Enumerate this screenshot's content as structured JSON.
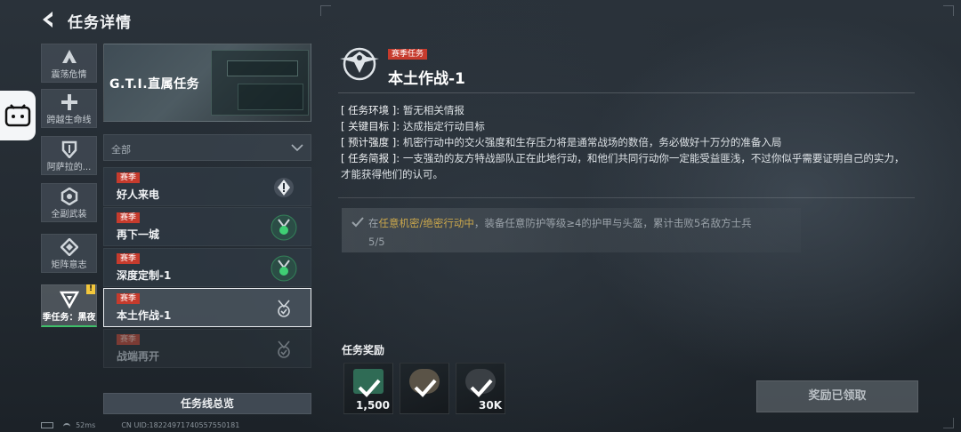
{
  "header": {
    "title": "任务详情"
  },
  "categories": [
    {
      "label": "震荡危情",
      "icon": "stacked-chevron-icon",
      "active": false
    },
    {
      "label": "跨越生命线",
      "icon": "cross-icon",
      "active": false
    },
    {
      "label": "阿萨拉的...",
      "icon": "shield-icon",
      "active": false
    },
    {
      "label": "全副武装",
      "icon": "ring-emblem-icon",
      "active": false
    },
    {
      "label": "矩阵意志",
      "icon": "diamond-arrows-icon",
      "active": false
    },
    {
      "label": "赛季任务：黑夜",
      "icon": "triangle-emblem-icon",
      "active": true,
      "badge": "!"
    }
  ],
  "banner": {
    "title": "G.T.I.直属任务"
  },
  "filter": {
    "selected": "全部"
  },
  "missions": [
    {
      "tag": "赛季",
      "name": "好人来电",
      "status": "alert-icon"
    },
    {
      "tag": "赛季",
      "name": "再下一城",
      "status": "medal-icon"
    },
    {
      "tag": "赛季",
      "name": "深度定制-1",
      "status": "medal-icon"
    },
    {
      "tag": "赛季",
      "name": "本土作战-1",
      "status": "completed-medal-icon"
    },
    {
      "tag": "赛季",
      "name": "战端再开",
      "status": "locked-medal-icon"
    }
  ],
  "overview_button": "任务线总览",
  "status_bar": {
    "ping": "52ms",
    "uid": "CN UID:18224971740557550181"
  },
  "detail": {
    "tag": "赛季任务",
    "title": "本土作战-1",
    "info": [
      {
        "key": "[ 任务环境 ]:",
        "value": "暂无相关情报"
      },
      {
        "key": "[ 关键目标 ]:",
        "value": "达成指定行动目标"
      },
      {
        "key": "[ 预计强度 ]:",
        "value": "机密行动中的交火强度和生存压力将是通常战场的数倍，务必做好十万分的准备入局"
      },
      {
        "key": "[ 任务简报 ]:",
        "value": "一支强劲的友方特战部队正在此地行动，和他们共同行动你一定能受益匪浅，不过你似乎需要证明自己的实力，才能获得他们的认可。"
      }
    ],
    "objective": {
      "prefix": "在",
      "highlight": "任意机密/绝密行动中",
      "suffix": "，装备任意防护等级≥4的护甲与头盔，累计击败5名敌方士兵",
      "progress": "5/5",
      "completed": true
    },
    "rewards_label": "任务奖励",
    "rewards": [
      {
        "count": "1,500",
        "color": "#2f6b55"
      },
      {
        "count": "",
        "color": "#5a5347"
      },
      {
        "count": "30K",
        "color": "#3a3f44"
      }
    ],
    "claim_button": "奖励已领取"
  }
}
